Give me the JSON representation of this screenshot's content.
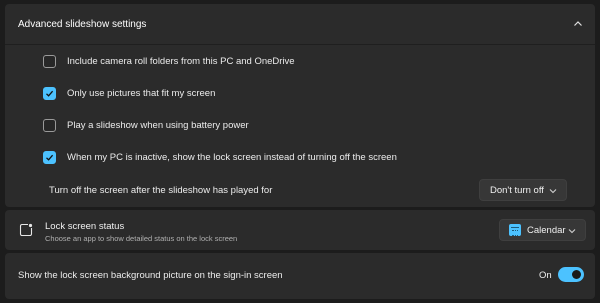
{
  "expander": {
    "title": "Advanced slideshow settings",
    "expanded": true,
    "options": [
      {
        "label": "Include camera roll folders from this PC and OneDrive",
        "checked": false
      },
      {
        "label": "Only use pictures that fit my screen",
        "checked": true
      },
      {
        "label": "Play a slideshow when using battery power",
        "checked": false
      },
      {
        "label": "When my PC is inactive, show the lock screen instead of turning off the screen",
        "checked": true
      }
    ],
    "turn_off": {
      "label": "Turn off the screen after the slideshow has played for",
      "value": "Don't turn off"
    }
  },
  "lock_status": {
    "title": "Lock screen status",
    "subtitle": "Choose an app to show detailed status on the lock screen",
    "value": "Calendar",
    "icon": "lock-screen-icon",
    "app_icon": "calendar-icon"
  },
  "signin_background": {
    "label": "Show the lock screen background picture on the sign-in screen",
    "state_label": "On",
    "on": true
  },
  "colors": {
    "accent": "#4cc2ff",
    "card": "#2b2b2b",
    "background": "#1c1c1c"
  }
}
